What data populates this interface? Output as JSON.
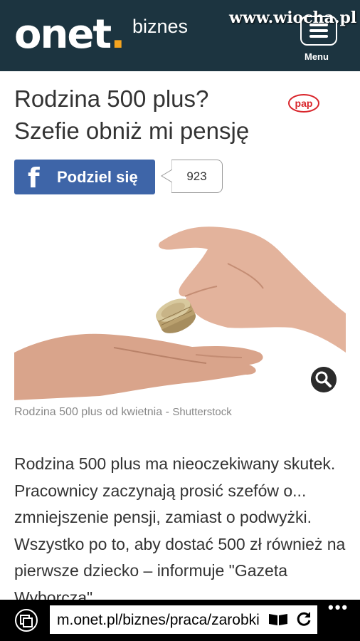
{
  "header": {
    "logo": "onet",
    "logo_dot": ".",
    "section": "biznes",
    "watermark": "www.wiocha.pl",
    "menu_label": "Menu"
  },
  "article": {
    "title_line1": "Rodzina 500 plus?",
    "title_line2": "Szefie obniż mi pensję",
    "agency": "pap"
  },
  "share": {
    "fb_icon": "f",
    "label": "Podziel się",
    "count": "923"
  },
  "image": {
    "caption": "Rodzina 500 plus od kwietnia",
    "separator": " - ",
    "source": "Shutterstock"
  },
  "lead": "Rodzina 500 plus ma nieoczekiwany skutek. Pracownicy zaczynają prosić szefów o... zmniejszenie pensji, zamiast o podwyżki. Wszystko po to, aby dostać 500 zł również na pierwsze dziecko – informuje \"Gazeta Wyborcza\".",
  "browser": {
    "url": "m.onet.pl/biznes/praca/zarobki",
    "more": "•••"
  },
  "colors": {
    "header_bg": "#1c3440",
    "logo_dot": "#f5a41f",
    "facebook": "#3e65a8",
    "pap": "#d9262c"
  }
}
